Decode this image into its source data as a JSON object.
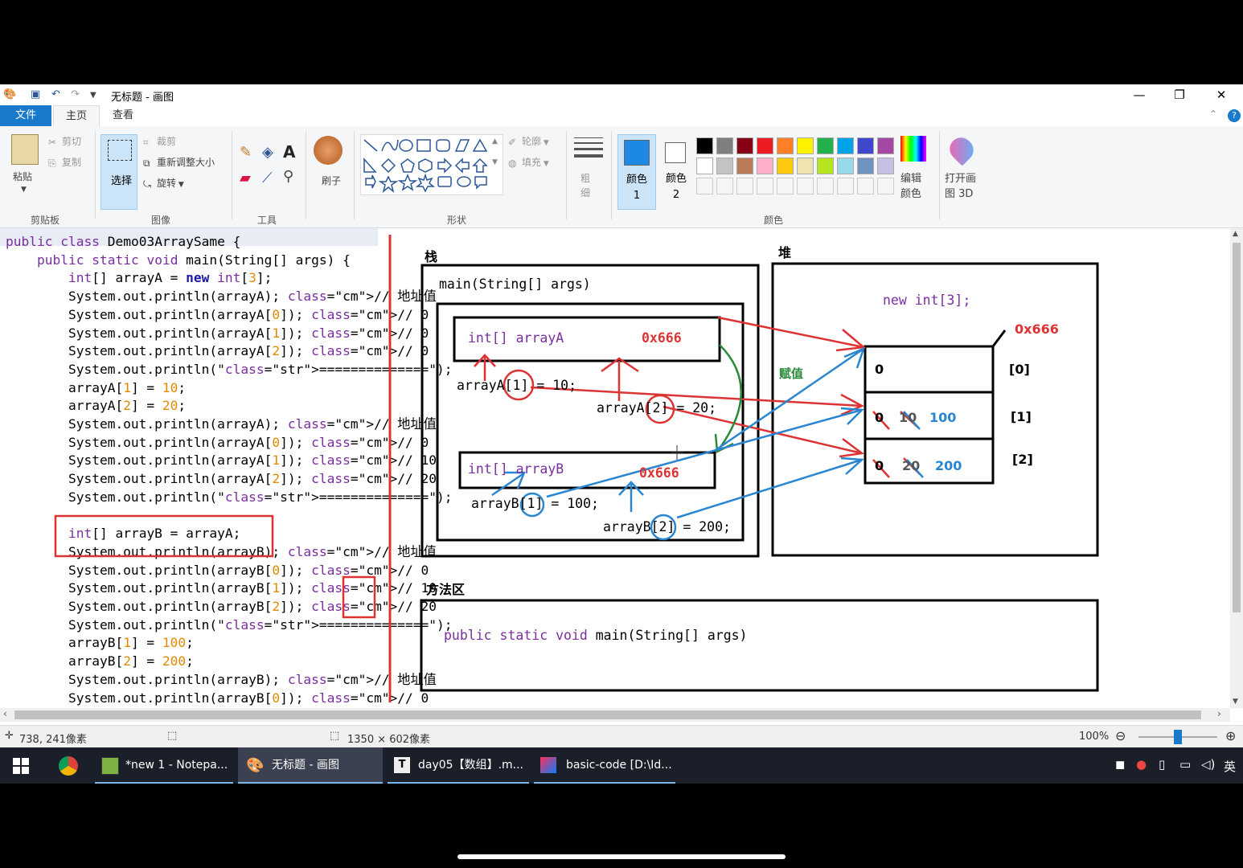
{
  "window": {
    "title": "无标题 - 画图",
    "minimize": "—",
    "restore": "❐",
    "close": "✕"
  },
  "menu": {
    "file": "文件",
    "home": "主页",
    "view": "查看"
  },
  "ribbon": {
    "clipboard": {
      "group": "剪贴板",
      "paste": "粘贴",
      "cut": "剪切",
      "copy": "复制"
    },
    "image": {
      "group": "图像",
      "select": "选择",
      "crop": "裁剪",
      "resize": "重新调整大小",
      "rotate": "旋转"
    },
    "tools": {
      "group": "工具"
    },
    "brushes": {
      "label": "刷子"
    },
    "shapes": {
      "group": "形状",
      "outline": "轮廓",
      "fill": "填充"
    },
    "size": {
      "label": "粗细"
    },
    "colors": {
      "group": "颜色",
      "color1": "颜色 1",
      "color2": "颜色 2",
      "edit": "编辑颜色",
      "paint3d": "打开画图 3D",
      "palette_row1": [
        "#000000",
        "#7f7f7f",
        "#880015",
        "#ed1c24",
        "#ff7f27",
        "#fff200",
        "#22b14c",
        "#00a2e8",
        "#3f48cc",
        "#a349a4"
      ],
      "palette_row2": [
        "#ffffff",
        "#c3c3c3",
        "#b97a57",
        "#ffaec9",
        "#ffc90e",
        "#efe4b0",
        "#b5e61d",
        "#99d9ea",
        "#7092be",
        "#c8bfe7"
      ]
    }
  },
  "code_lines": [
    "public class Demo03ArraySame {",
    "    public static void main(String[] args) {",
    "        int[] arrayA = new int[3];",
    "        System.out.println(arrayA); // 地址值",
    "        System.out.println(arrayA[0]); // 0",
    "        System.out.println(arrayA[1]); // 0",
    "        System.out.println(arrayA[2]); // 0",
    "        System.out.println(\"==============\");",
    "        arrayA[1] = 10;",
    "        arrayA[2] = 20;",
    "        System.out.println(arrayA); // 地址值",
    "        System.out.println(arrayA[0]); // 0",
    "        System.out.println(arrayA[1]); // 10",
    "        System.out.println(arrayA[2]); // 20",
    "        System.out.println(\"==============\");",
    "",
    "        int[] arrayB = arrayA;",
    "        System.out.println(arrayB); // 地址值",
    "        System.out.println(arrayB[0]); // 0",
    "        System.out.println(arrayB[1]); // 10",
    "        System.out.println(arrayB[2]); // 20",
    "        System.out.println(\"==============\");",
    "        arrayB[1] = 100;",
    "        arrayB[2] = 200;",
    "        System.out.println(arrayB); // 地址值",
    "        System.out.println(arrayB[0]); // 0"
  ],
  "diagram": {
    "stack_label": "栈",
    "heap_label": "堆",
    "method_area_label": "方法区",
    "main_frame": "main(String[] args)",
    "var_a": "int[] arrayA",
    "var_b": "int[] arrayB",
    "addr": "0x666",
    "assign_a1": "arrayA[1] = 10;",
    "assign_a2": "arrayA[2] = 20;",
    "assign_b1": "arrayB[1] = 100;",
    "assign_b2": "arrayB[2] = 200;",
    "new_expr": "new int[3];",
    "assign_label": "赋值",
    "cell0": "0",
    "cell1_old": "0",
    "cell1_mid": "10",
    "cell1_new": "100",
    "cell2_old": "0",
    "cell2_mid": "20",
    "cell2_new": "200",
    "idx0": "[0]",
    "idx1": "[1]",
    "idx2": "[2]",
    "method_sig": "public static void main(String[] args)"
  },
  "status": {
    "cursor": "738, 241像素",
    "size": "1350 × 602像素",
    "zoom": "100%"
  },
  "taskbar": {
    "notepad": "*new 1 - Notepa...",
    "paint": "无标题 - 画图",
    "typora": "day05【数组】.m...",
    "idea": "basic-code [D:\\Id...",
    "ime": "英"
  }
}
